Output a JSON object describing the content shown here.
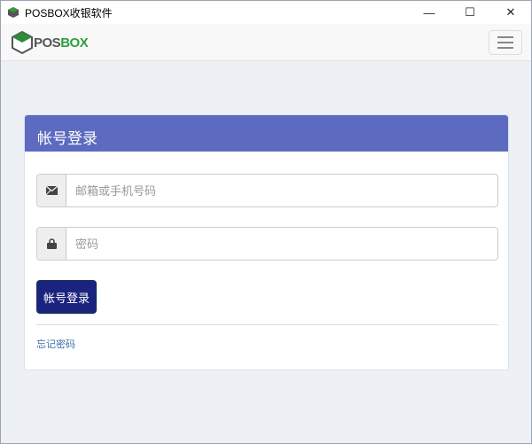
{
  "window": {
    "title": "POSBOX收银软件",
    "minimize": "—",
    "maximize": "☐",
    "close": "✕"
  },
  "navbar": {
    "logo_part1": "POS",
    "logo_part2": "BOX"
  },
  "login": {
    "title": "帐号登录",
    "email_placeholder": "邮箱或手机号码",
    "password_placeholder": "密码",
    "submit_label": "帐号登录",
    "forgot_label": "忘记密码"
  },
  "colors": {
    "header": "#5c6bc0",
    "button": "#1a237e",
    "logo_green": "#2e9e3e"
  }
}
